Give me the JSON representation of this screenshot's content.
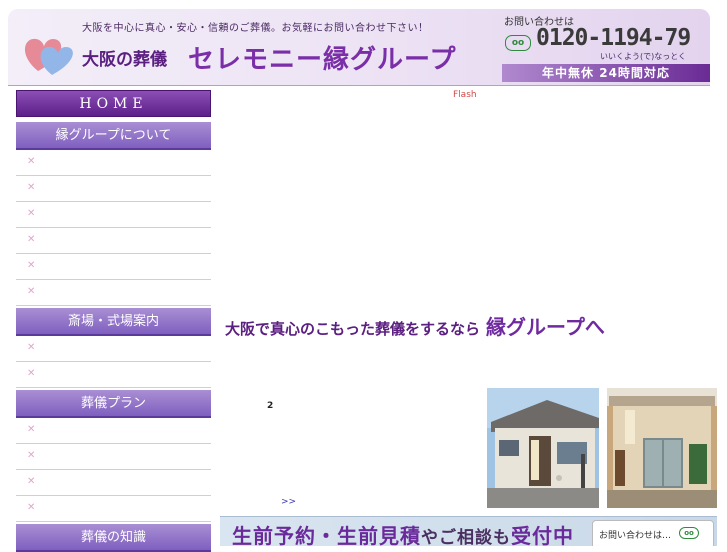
{
  "header": {
    "tagline": "大阪を中心に真心・安心・信頼のご葬儀。お気軽にお問い合わせ下さい！",
    "brand_sub": "大阪の葬儀",
    "brand_main": "セレモニー縁グループ",
    "inquiry_label": "お問い合わせは",
    "freedial_icon_text": "oo",
    "phone_number": "0120-1194-79",
    "phone_reading": "いいくよう(で)なっとく",
    "hours": "年中無休 24時間対応"
  },
  "sidebar": {
    "home_label": "HOME",
    "sections": [
      {
        "title": "縁グループについて",
        "items": 6
      },
      {
        "title": "斎場・式場案内",
        "items": 2
      },
      {
        "title": "葬儀プラン",
        "items": 4
      },
      {
        "title": "葬儀の知識",
        "items": 0
      }
    ],
    "item_marker": "✕"
  },
  "main": {
    "flash_text": "Flash",
    "catch_small": "大阪で真心のこもった葬儀をするなら",
    "catch_big": "縁グループへ",
    "marker_2": "2",
    "more_link": ">>",
    "banner_big1": "生前予約・生前見積",
    "banner_mid": "やご相談も",
    "banner_big2": "受付中",
    "banner_inquiry": "お問い合わせは…",
    "banner_icon_text": "oo"
  },
  "colors": {
    "brand_purple": "#7a2fa8",
    "sidebar_head": "#8f71c9",
    "freedial_green": "#2f8a3c",
    "flash_red": "#d24a4a"
  }
}
